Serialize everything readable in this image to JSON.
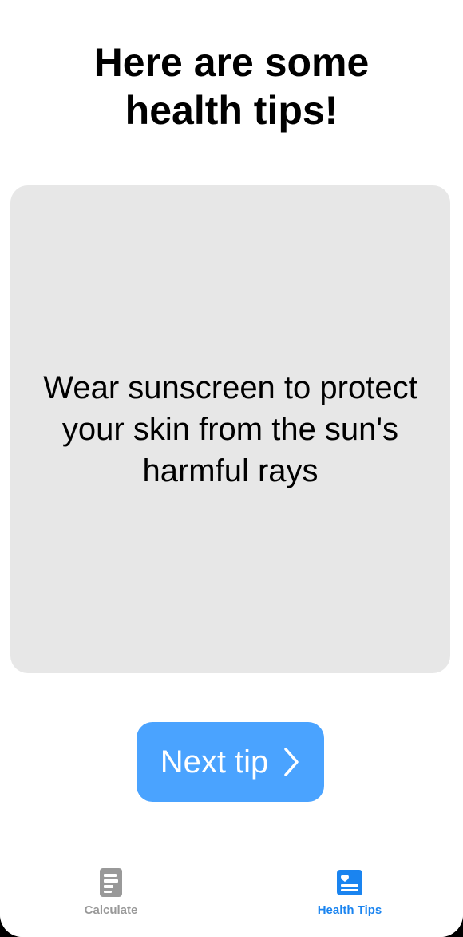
{
  "header": {
    "title": "Here are some\nhealth tips!"
  },
  "tip_card": {
    "text": "Wear sunscreen to protect your skin from the sun's harmful rays"
  },
  "next_button": {
    "label": "Next tip",
    "icon": "chevron-right-icon"
  },
  "tab_bar": {
    "items": [
      {
        "label": "Calculate",
        "icon": "calculator-document-icon",
        "selected": false
      },
      {
        "label": "Health Tips",
        "icon": "health-tips-heart-icon",
        "selected": true
      }
    ]
  },
  "colors": {
    "accent": "#1a84f0",
    "button": "#4aa3ff",
    "card": "#e7e7e7",
    "inactive_tab": "#999999"
  }
}
